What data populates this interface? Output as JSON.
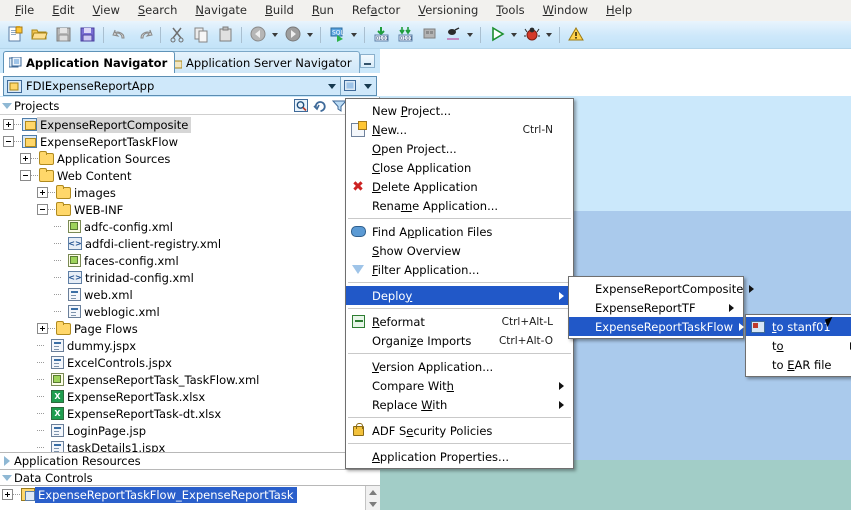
{
  "menubar": {
    "items": [
      {
        "pre": "",
        "mn": "F",
        "post": "ile"
      },
      {
        "pre": "",
        "mn": "E",
        "post": "dit"
      },
      {
        "pre": "",
        "mn": "V",
        "post": "iew"
      },
      {
        "pre": "",
        "mn": "S",
        "post": "earch"
      },
      {
        "pre": "",
        "mn": "N",
        "post": "avigate"
      },
      {
        "pre": "",
        "mn": "B",
        "post": "uild"
      },
      {
        "pre": "",
        "mn": "R",
        "post": "un"
      },
      {
        "pre": "Ref",
        "mn": "a",
        "post": "ctor"
      },
      {
        "pre": "",
        "mn": "V",
        "post": "ersioning"
      },
      {
        "pre": "",
        "mn": "T",
        "post": "ools"
      },
      {
        "pre": "",
        "mn": "W",
        "post": "indow"
      },
      {
        "pre": "",
        "mn": "H",
        "post": "elp"
      }
    ]
  },
  "toolbar": {
    "icons": [
      "new-file-icon",
      "open-folder-icon",
      "save-icon",
      "save-all-icon",
      "undo-icon",
      "redo-icon",
      "cut-icon",
      "copy-icon",
      "paste-icon",
      "back-icon",
      "forward-icon",
      "sql-worksheet-icon",
      "make-icon",
      "rebuild-icon",
      "deploy-icon",
      "run-ant-icon",
      "run-icon",
      "debug-icon",
      "audit-icon"
    ]
  },
  "tabs": {
    "application_navigator": "Application Navigator",
    "application_server_navigator": "Application Server Navigator",
    "minimize_title": "Minimize"
  },
  "app_combo": {
    "value": "FDIExpenseReportApp",
    "icon": "application-icon"
  },
  "projects_panel": {
    "title": "Projects",
    "tools": [
      "search-icon",
      "refresh-icon",
      "filter-icon",
      "view-options-icon"
    ]
  },
  "tree": {
    "nodes": [
      {
        "label": "ExpenseReportComposite",
        "indent": 0,
        "expander": "plus",
        "icon": "project-icon",
        "state": "sel-grey"
      },
      {
        "label": "ExpenseReportTaskFlow",
        "indent": 0,
        "expander": "minus",
        "icon": "project-icon",
        "state": ""
      },
      {
        "label": "Application Sources",
        "indent": 1,
        "expander": "plus",
        "icon": "folder-icon",
        "state": ""
      },
      {
        "label": "Web Content",
        "indent": 1,
        "expander": "minus",
        "icon": "folder-icon",
        "state": ""
      },
      {
        "label": "images",
        "indent": 2,
        "expander": "plus",
        "icon": "folder-icon",
        "state": ""
      },
      {
        "label": "WEB-INF",
        "indent": 2,
        "expander": "minus",
        "icon": "folder-icon",
        "state": ""
      },
      {
        "label": "adfc-config.xml",
        "indent": 3,
        "expander": "none",
        "icon": "adfc-config-icon",
        "state": ""
      },
      {
        "label": "adfdi-client-registry.xml",
        "indent": 3,
        "expander": "none",
        "icon": "xml-icon",
        "state": ""
      },
      {
        "label": "faces-config.xml",
        "indent": 3,
        "expander": "none",
        "icon": "faces-config-icon",
        "state": ""
      },
      {
        "label": "trinidad-config.xml",
        "indent": 3,
        "expander": "none",
        "icon": "xml-icon",
        "state": ""
      },
      {
        "label": "web.xml",
        "indent": 3,
        "expander": "none",
        "icon": "web-xml-icon",
        "state": ""
      },
      {
        "label": "weblogic.xml",
        "indent": 3,
        "expander": "none",
        "icon": "web-xml-icon",
        "state": ""
      },
      {
        "label": "Page Flows",
        "indent": 2,
        "expander": "plus",
        "icon": "folder-icon",
        "state": ""
      },
      {
        "label": "dummy.jspx",
        "indent": 2,
        "expander": "none",
        "icon": "jspx-icon",
        "state": ""
      },
      {
        "label": "ExcelControls.jspx",
        "indent": 2,
        "expander": "none",
        "icon": "jspx-icon",
        "state": ""
      },
      {
        "label": "ExpenseReportTask_TaskFlow.xml",
        "indent": 2,
        "expander": "none",
        "icon": "taskflow-icon",
        "state": ""
      },
      {
        "label": "ExpenseReportTask.xlsx",
        "indent": 2,
        "expander": "none",
        "icon": "excel-icon",
        "state": ""
      },
      {
        "label": "ExpenseReportTask-dt.xlsx",
        "indent": 2,
        "expander": "none",
        "icon": "excel-icon",
        "state": ""
      },
      {
        "label": "LoginPage.jsp",
        "indent": 2,
        "expander": "none",
        "icon": "jspx-icon",
        "state": ""
      },
      {
        "label": "taskDetails1.jspx",
        "indent": 2,
        "expander": "none",
        "icon": "jspx-icon",
        "state": ""
      }
    ]
  },
  "accordion": {
    "application_resources": "Application Resources",
    "data_controls": "Data Controls"
  },
  "data_controls": {
    "selected_node": "ExpenseReportTaskFlow_ExpenseReportTask"
  },
  "context_menu": {
    "items": [
      {
        "pre": "New ",
        "mn": "P",
        "post": "roject...",
        "icon": "",
        "accel": "",
        "sub": false,
        "hl": false
      },
      {
        "pre": "",
        "mn": "N",
        "post": "ew...",
        "icon": "new-icon",
        "accel": "Ctrl-N",
        "sub": false,
        "hl": false
      },
      {
        "pre": "",
        "mn": "O",
        "post": "pen Project...",
        "icon": "",
        "accel": "",
        "sub": false,
        "hl": false
      },
      {
        "pre": "",
        "mn": "C",
        "post": "lose Application",
        "icon": "",
        "accel": "",
        "sub": false,
        "hl": false
      },
      {
        "pre": "",
        "mn": "D",
        "post": "elete Application",
        "icon": "delete-icon",
        "accel": "",
        "sub": false,
        "hl": false
      },
      {
        "pre": "Rena",
        "mn": "m",
        "post": "e Application...",
        "icon": "",
        "accel": "",
        "sub": false,
        "hl": false
      },
      {
        "sep": true
      },
      {
        "pre": "Find A",
        "mn": "p",
        "post": "plication Files",
        "icon": "find-icon",
        "accel": "",
        "sub": false,
        "hl": false
      },
      {
        "pre": "",
        "mn": "S",
        "post": "how Overview",
        "icon": "",
        "accel": "",
        "sub": false,
        "hl": false
      },
      {
        "pre": "",
        "mn": "F",
        "post": "ilter Application...",
        "icon": "filter-icon",
        "accel": "",
        "sub": false,
        "hl": false
      },
      {
        "sep": true
      },
      {
        "pre": "Deplo",
        "mn": "y",
        "post": "",
        "icon": "",
        "accel": "",
        "sub": true,
        "hl": true
      },
      {
        "sep": true
      },
      {
        "pre": "",
        "mn": "R",
        "post": "eformat",
        "icon": "reformat-icon",
        "accel": "Ctrl+Alt-L",
        "sub": false,
        "hl": false
      },
      {
        "pre": "Organi",
        "mn": "z",
        "post": "e Imports",
        "icon": "",
        "accel": "Ctrl+Alt-O",
        "sub": false,
        "hl": false
      },
      {
        "sep": true
      },
      {
        "pre": "",
        "mn": "V",
        "post": "ersion Application...",
        "icon": "",
        "accel": "",
        "sub": false,
        "hl": false
      },
      {
        "pre": "Compare Wit",
        "mn": "h",
        "post": "",
        "icon": "",
        "accel": "",
        "sub": true,
        "hl": false
      },
      {
        "pre": "Replace ",
        "mn": "W",
        "post": "ith",
        "icon": "",
        "accel": "",
        "sub": true,
        "hl": false
      },
      {
        "sep": true
      },
      {
        "pre": "ADF S",
        "mn": "e",
        "post": "curity Policies",
        "icon": "lock-icon",
        "accel": "",
        "sub": false,
        "hl": false
      },
      {
        "sep": true
      },
      {
        "pre": "",
        "mn": "A",
        "post": "pplication Properties...",
        "icon": "",
        "accel": "",
        "sub": false,
        "hl": false
      }
    ]
  },
  "deploy_submenu": {
    "items": [
      {
        "label": "ExpenseReportComposite",
        "sub": true,
        "hl": false
      },
      {
        "label": "ExpenseReportTF",
        "sub": true,
        "hl": false
      },
      {
        "label": "ExpenseReportTaskFlow",
        "sub": true,
        "hl": true
      }
    ]
  },
  "target_submenu": {
    "items": [
      {
        "pre": "",
        "mn": "t",
        "post": "o stanf01",
        "icon": "deploy-profile-icon",
        "sub": false,
        "hl": true
      },
      {
        "pre": "t",
        "mn": "o",
        "post": "",
        "icon": "",
        "sub": true,
        "hl": false
      },
      {
        "pre": "to ",
        "mn": "E",
        "post": "AR file",
        "icon": "",
        "sub": false,
        "hl": false
      }
    ]
  },
  "colors": {
    "highlight": "#2158c8",
    "tree_selection": "#2a5fcb",
    "desktop_light": "#cbe8fb",
    "desktop_mid": "#aacaec",
    "desktop_teal": "#a2cdc7",
    "toolbar": "#cde8fa"
  }
}
